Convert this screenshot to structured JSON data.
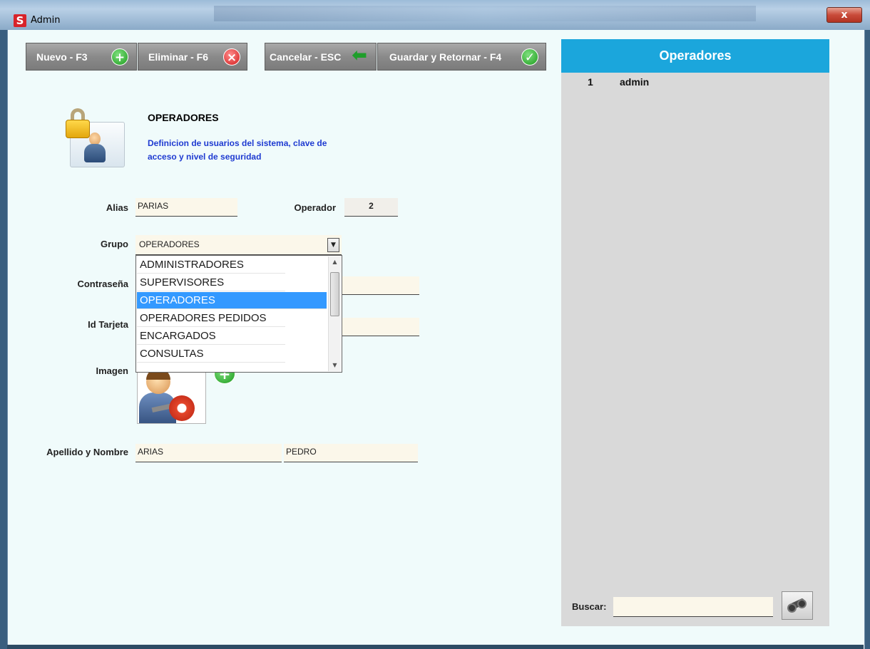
{
  "window": {
    "title": "Admin",
    "logo_letter": "S",
    "close_label": "x"
  },
  "toolbar": {
    "new_label": "Nuevo - F3",
    "delete_label": "Eliminar - F6",
    "cancel_label": "Cancelar - ESC",
    "save_label": "Guardar y Retornar - F4",
    "icons": [
      "plus-circle-icon",
      "x-circle-icon",
      "back-arrow-icon",
      "check-circle-icon"
    ]
  },
  "header": {
    "title": "OPERADORES",
    "description": "Definicion de usuarios del sistema, clave de acceso y nivel de seguridad"
  },
  "form": {
    "alias_label": "Alias",
    "alias_value": "PARIAS",
    "operator_label": "Operador",
    "operator_value": "2",
    "group_label": "Grupo",
    "group_value": "OPERADORES",
    "group_options": [
      "ADMINISTRADORES",
      "SUPERVISORES",
      "OPERADORES",
      "OPERADORES PEDIDOS",
      "ENCARGADOS",
      "CONSULTAS"
    ],
    "group_selected_index": 2,
    "password_label": "Contraseña",
    "password_value": "",
    "card_label": "Id Tarjeta",
    "card_value": "",
    "image_label": "Imagen",
    "name_label": "Apellido y Nombre",
    "last_name_value": "ARIAS",
    "first_name_value": "PEDRO"
  },
  "panel": {
    "title": "Operadores",
    "rows": [
      {
        "id": "1",
        "name": "admin"
      }
    ],
    "search_label": "Buscar:",
    "search_value": ""
  },
  "colors": {
    "panel_header": "#1ba6dc",
    "selection": "#3399ff",
    "description_text": "#1f3bd1",
    "background": "#f0fbfb"
  }
}
